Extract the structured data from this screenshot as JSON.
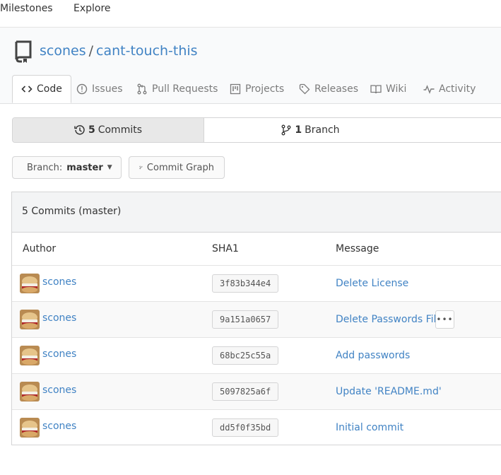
{
  "topnav": {
    "milestones": "Milestones",
    "explore": "Explore"
  },
  "repo": {
    "owner": "scones",
    "separator": "/",
    "name": "cant-touch-this"
  },
  "tabs": [
    {
      "label": "Code",
      "icon": "code-icon",
      "active": true
    },
    {
      "label": "Issues",
      "icon": "issue-icon"
    },
    {
      "label": "Pull Requests",
      "icon": "pull-request-icon"
    },
    {
      "label": "Projects",
      "icon": "project-icon"
    },
    {
      "label": "Releases",
      "icon": "tag-icon"
    },
    {
      "label": "Wiki",
      "icon": "book-icon"
    },
    {
      "label": "Activity",
      "icon": "pulse-icon"
    }
  ],
  "stats": {
    "commits_count": "5",
    "commits_label": "Commits",
    "branch_count": "1",
    "branch_label": "Branch"
  },
  "buttons": {
    "branch_prefix": "Branch:",
    "branch_name": "master",
    "commit_graph": "Commit Graph"
  },
  "table": {
    "title": "5 Commits (master)",
    "headers": {
      "author": "Author",
      "sha": "SHA1",
      "message": "Message"
    },
    "rows": [
      {
        "author": "scones",
        "sha": "3f83b344e4",
        "message": "Delete License"
      },
      {
        "author": "scones",
        "sha": "9a151a0657",
        "message": "Delete Passwords File",
        "more": "•••"
      },
      {
        "author": "scones",
        "sha": "68bc25c55a",
        "message": "Add passwords"
      },
      {
        "author": "scones",
        "sha": "5097825a6f",
        "message": "Update 'README.md'"
      },
      {
        "author": "scones",
        "sha": "dd5f0f35bd",
        "message": "Initial commit"
      }
    ]
  },
  "colors": {
    "link": "#4183c4",
    "active_stat_bg": "#e8e8e8",
    "header_bg": "#f3f4f5"
  }
}
